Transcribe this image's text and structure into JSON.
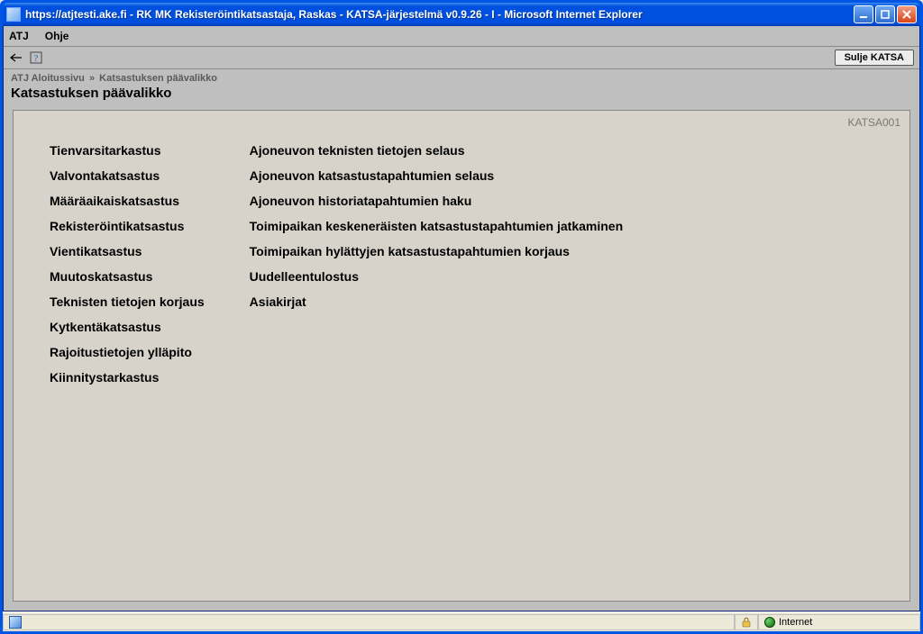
{
  "window": {
    "title": "https://atjtesti.ake.fi - RK MK Rekisteröintikatsastaja, Raskas - KATSA-järjestelmä v0.9.26 - I - Microsoft Internet Explorer"
  },
  "menubar": {
    "items": [
      "ATJ",
      "Ohje"
    ]
  },
  "toolbar": {
    "close_label": "Sulje KATSA"
  },
  "breadcrumb": {
    "root": "ATJ Aloitussivu",
    "current": "Katsastuksen päävalikko"
  },
  "page": {
    "title": "Katsastuksen päävalikko",
    "code": "KATSA001"
  },
  "menu": {
    "col1": [
      "Tienvarsitarkastus",
      "Valvontakatsastus",
      "Määräaikaiskatsastus",
      "Rekisteröintikatsastus",
      "Vientikatsastus",
      "Muutoskatsastus",
      "Teknisten tietojen korjaus",
      "Kytkentäkatsastus",
      "Rajoitustietojen ylläpito",
      "Kiinnitystarkastus"
    ],
    "col2": [
      "Ajoneuvon teknisten tietojen selaus",
      "Ajoneuvon katsastustapahtumien selaus",
      "Ajoneuvon historiatapahtumien haku",
      "Toimipaikan keskeneräisten katsastustapahtumien jatkaminen",
      "Toimipaikan hylättyjen katsastustapahtumien korjaus",
      "Uudelleentulostus",
      "Asiakirjat"
    ]
  },
  "statusbar": {
    "zone": "Internet"
  }
}
